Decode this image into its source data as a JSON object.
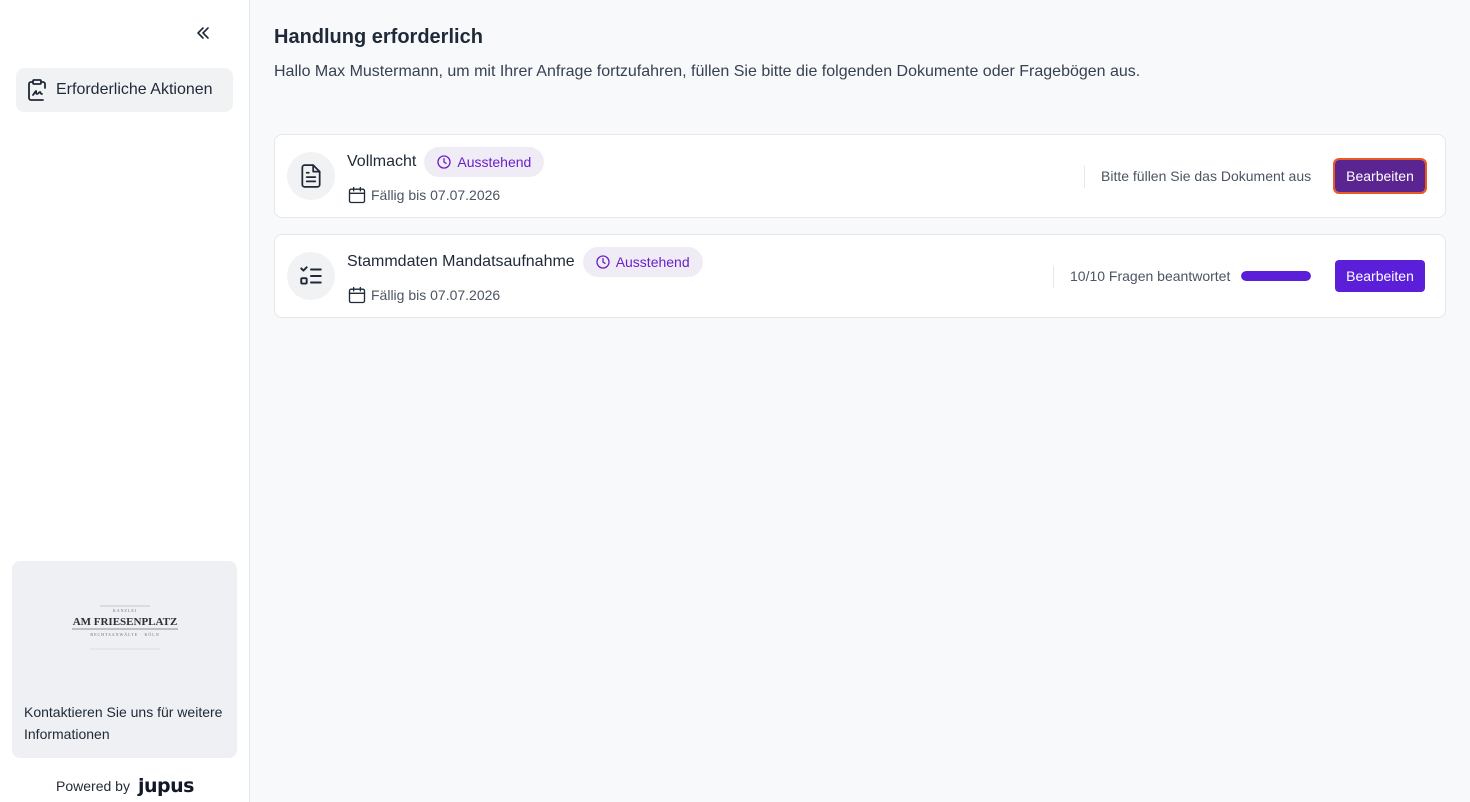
{
  "sidebar": {
    "collapse_icon": "double-chevron-left-icon",
    "nav_items": [
      {
        "label": "Erforderliche Aktionen",
        "icon": "clipboard-signature-icon",
        "active": true
      }
    ],
    "contact": {
      "logo_text": "AM FRIESENPLATZ",
      "text": "Kontaktieren Sie uns für weitere Informationen"
    },
    "powered_by": {
      "label": "Powered by",
      "brand": "jupus"
    }
  },
  "main": {
    "title": "Handlung erforderlich",
    "subtitle": "Hallo Max Mustermann, um mit Ihrer Anfrage fortzufahren, füllen Sie bitte die folgenden Dokumente oder Fragebögen aus.",
    "items": [
      {
        "title": "Vollmacht",
        "icon": "document-icon",
        "status": "Ausstehend",
        "due": "Fällig bis 07.07.2026",
        "info": "Bitte füllen Sie das Dokument aus",
        "button": "Bearbeiten"
      },
      {
        "title": "Stammdaten Mandatsaufnahme",
        "icon": "checklist-icon",
        "status": "Ausstehend",
        "due": "Fällig bis 07.07.2026",
        "info": "10/10 Fragen beantwortet",
        "progress": 1.0,
        "button": "Bearbeiten"
      }
    ]
  },
  "colors": {
    "accent": "#5b1fd9",
    "badge_bg": "#f0ecf6",
    "badge_text": "#6b21c8",
    "focus_ring": "#e85a1e"
  }
}
